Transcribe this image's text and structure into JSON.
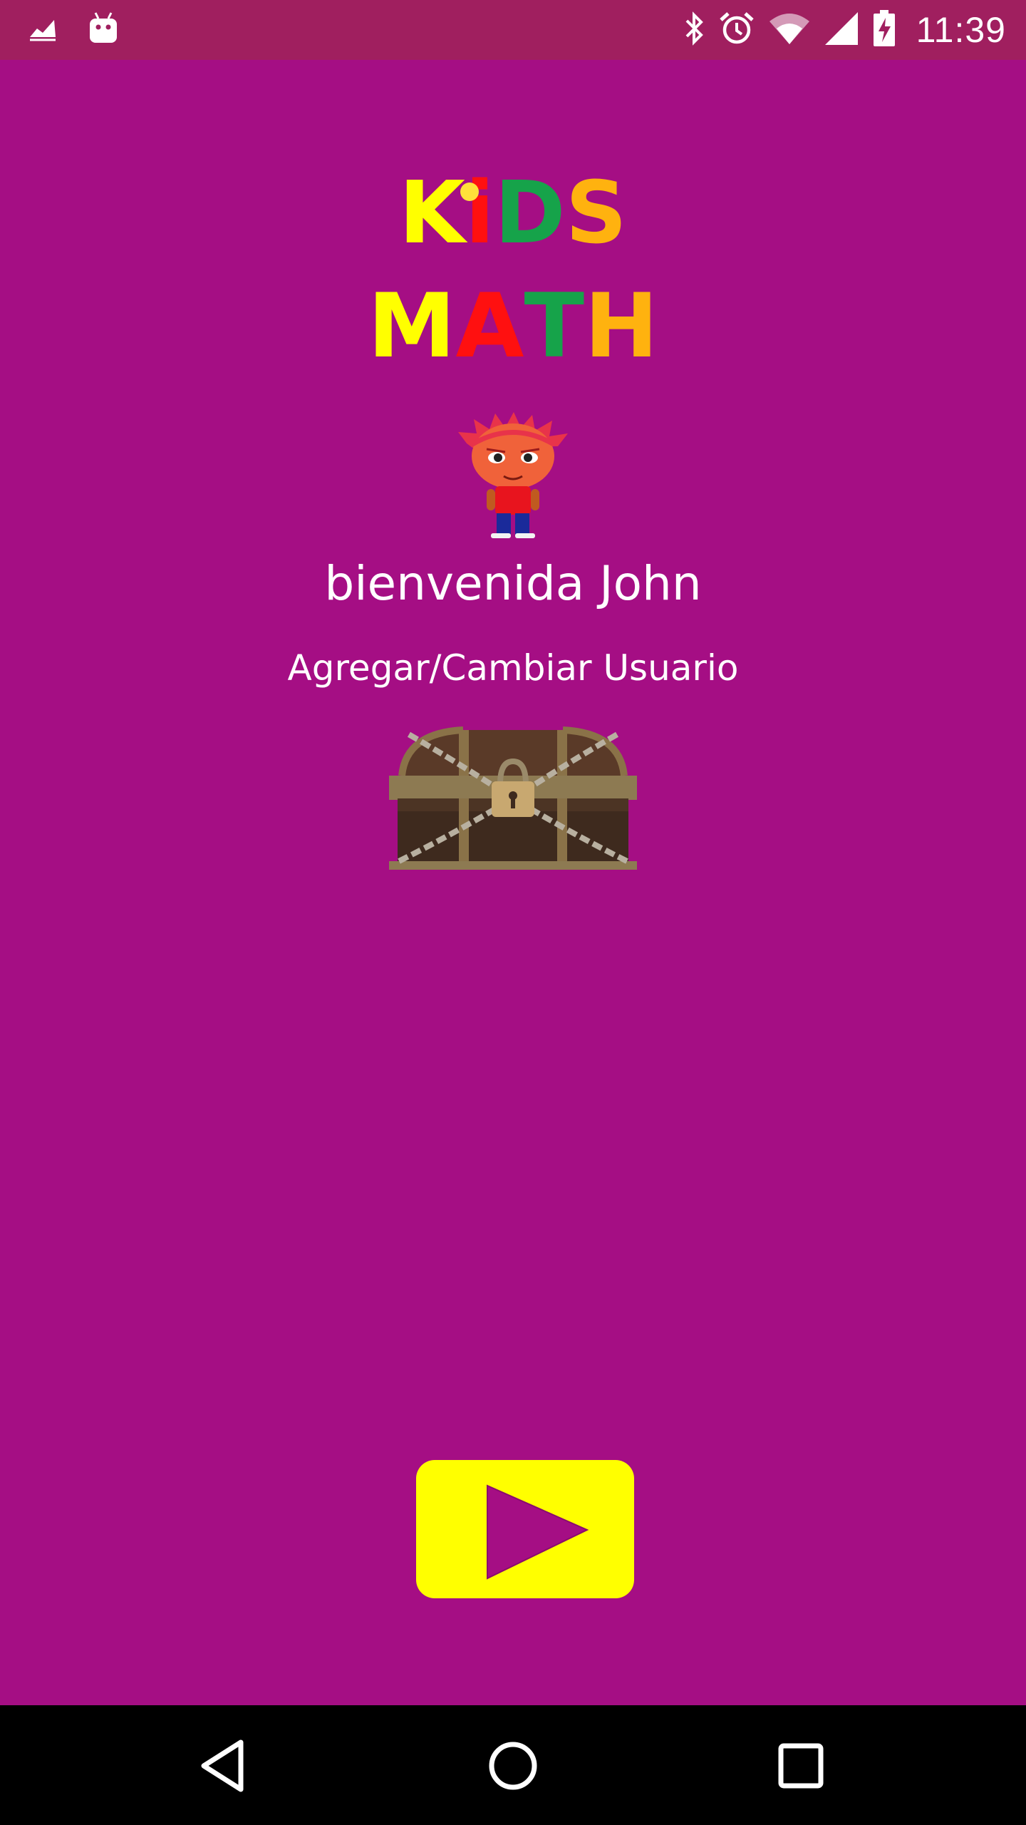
{
  "status_bar": {
    "time": "11:39",
    "left_icons": [
      "chart-icon",
      "android-icon"
    ],
    "right_icons": [
      "bluetooth-icon",
      "alarm-icon",
      "wifi-icon",
      "signal-icon",
      "battery-charging-icon"
    ]
  },
  "logo": {
    "line1": [
      {
        "char": "K",
        "color": "#ffff00"
      },
      {
        "char": "i",
        "color": "#ff1010"
      },
      {
        "char": "D",
        "color": "#16a34a"
      },
      {
        "char": "S",
        "color": "#ffb20f"
      }
    ],
    "line2": [
      {
        "char": "M",
        "color": "#ffff00"
      },
      {
        "char": "A",
        "color": "#ff1010"
      },
      {
        "char": "T",
        "color": "#16a34a"
      },
      {
        "char": "H",
        "color": "#ffb20f"
      }
    ]
  },
  "greeting": "bienvenida John",
  "switch_user_label": "Agregar/Cambiar Usuario",
  "chest_icon": "locked-treasure-chest-icon",
  "play_icon": "play-icon",
  "nav": {
    "back_icon": "back-triangle-icon",
    "home_icon": "home-circle-icon",
    "recents_icon": "recents-square-icon"
  },
  "colors": {
    "background": "#a50e84",
    "status_bar": "#a01f5f",
    "play_button": "#ffff00",
    "play_triangle": "#a50e84",
    "nav_bar": "#000000"
  }
}
